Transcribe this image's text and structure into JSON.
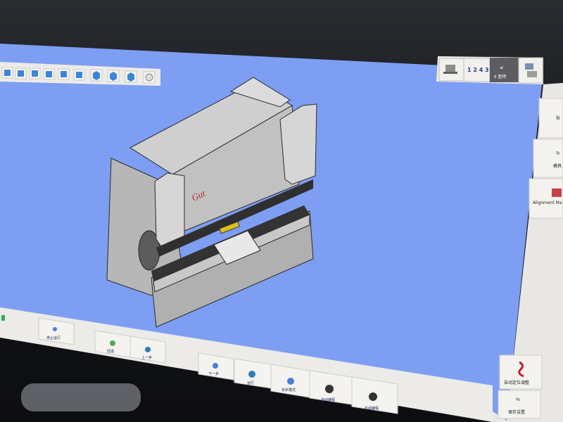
{
  "colors": {
    "viewport": "#7d9ef2",
    "toolbar": "#ecebe7",
    "machine_body": "#b7b7b7",
    "accent_red": "#c0202a"
  },
  "view_toolbar": {
    "buttons": [
      "view-front-icon",
      "view-back-icon",
      "view-left-icon",
      "view-right-icon",
      "view-top-icon",
      "view-bottom-icon",
      "view-iso-1-icon",
      "view-iso-2-icon",
      "view-iso-3-icon"
    ]
  },
  "top_right_toolbar": {
    "numbers": "1 2 4 3",
    "pause_label": "II 暂停"
  },
  "model": {
    "brand_text": "Gut",
    "sub_text": "——"
  },
  "side_panel": {
    "item1": "拆",
    "item2": "模具",
    "item3": "Alignment Ma",
    "item4": "自动定位调整",
    "item5": "保存设置"
  },
  "bottom_toolbar": {
    "b1": "停止运行",
    "b2": "回退",
    "b3": "上一步",
    "b4": "下一步",
    "b5": "运行",
    "b6": "单步模式",
    "b7": "自动编程",
    "b8": "手动编程"
  }
}
